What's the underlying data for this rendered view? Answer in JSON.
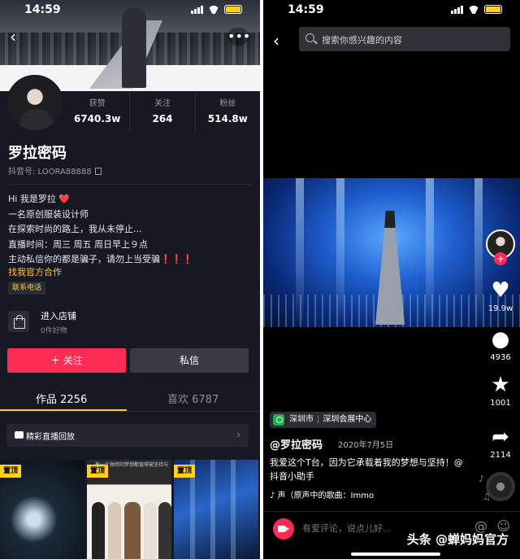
{
  "left": {
    "status": {
      "time": "14:59"
    },
    "stats": [
      {
        "label": "获赞",
        "value": "6740.3w"
      },
      {
        "label": "关注",
        "value": "264"
      },
      {
        "label": "粉丝",
        "value": "514.8w"
      }
    ],
    "name": "罗拉密码",
    "douyin_id": "抖音号: LOORA88888",
    "bio": [
      "Hi 我是罗拉",
      "一名原创服装设计师",
      "在探索时尚的路上，我从未停止...",
      "直播时间：周三 周五 周日早上９点",
      "主动私信你的都是骗子，请勿上当受骗"
    ],
    "bio_heart": "❤️",
    "bio_bangs": "❗❗❗",
    "biz_link": "找我官方合作",
    "contact_tag": "联系电话",
    "shop": {
      "title": "进入店铺",
      "subtitle": "0件好物"
    },
    "follow_label": "＋ 关注",
    "message_label": "私信",
    "tabs": [
      {
        "label": "作品 2256"
      },
      {
        "label": "喜欢 6787"
      }
    ],
    "replay_label": "精彩直播回放",
    "pin_label": "置顶",
    "thumb_text": "每一个独特的梦想都值得被坚持与努力"
  },
  "right": {
    "status": {
      "time": "14:59"
    },
    "search_placeholder": "搜索你感兴趣的内容",
    "likes": "19.9w",
    "comments": "4936",
    "favorites": "1001",
    "shares": "2114",
    "location_city": "深圳市",
    "location_venue": "深圳会展中心",
    "author": "@罗拉密码",
    "date": "2020年7月5日",
    "caption": "我爱这个T台，因为它承载着我的梦想与坚持！@抖音小助手",
    "music": "♪ 声（原声中的歌曲：Immo",
    "comment_placeholder": "有爱评论，说点儿好...",
    "watermark": "头条 @蝉妈妈官方"
  },
  "colors": {
    "accent": "#fe2c55",
    "highlight": "#facb2e",
    "bg_dark": "#161823"
  },
  "icons": [
    "back-arrow-icon",
    "more-icon",
    "copy-icon",
    "shopping-bag-icon",
    "search-icon",
    "heart-icon",
    "comment-icon",
    "star-icon",
    "share-icon",
    "camera-icon",
    "at-icon",
    "emoji-icon",
    "location-pin-icon",
    "music-note-icon"
  ]
}
